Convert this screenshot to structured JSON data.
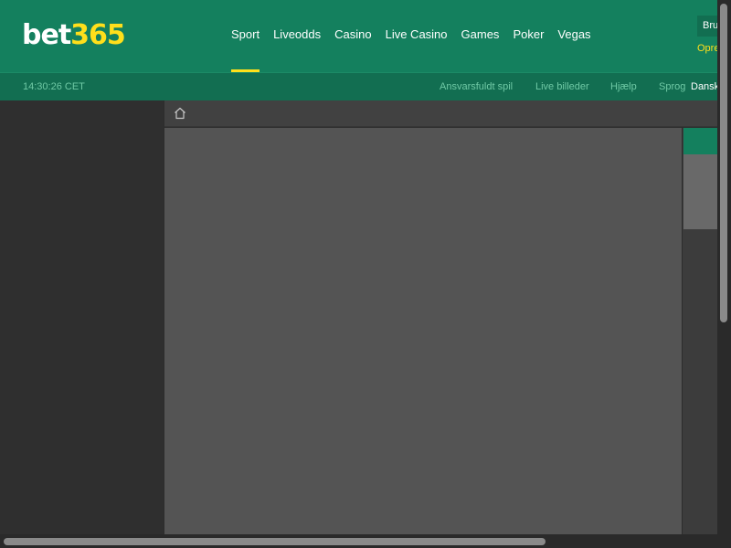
{
  "header": {
    "logo": {
      "part1": "bet",
      "part2": "365"
    },
    "nav": [
      {
        "label": "Sport",
        "active": true
      },
      {
        "label": "Liveodds"
      },
      {
        "label": "Casino"
      },
      {
        "label": "Live Casino"
      },
      {
        "label": "Games"
      },
      {
        "label": "Poker"
      },
      {
        "label": "Vegas"
      }
    ],
    "login_button": "Bru",
    "join_link": "Opre"
  },
  "subheader": {
    "clock": "14:30:26 CET",
    "links": {
      "responsible_gambling": "Ansvarsfuldt spil",
      "live_images": "Live billeder",
      "help": "Hjælp",
      "language_label": "Sprog"
    },
    "language_value": "Dansk"
  },
  "breadcrumb": {
    "icon": "home-icon"
  },
  "colors": {
    "brand_green": "#14805e",
    "brand_green_dark": "#126e51",
    "accent_yellow": "#ffdf1b",
    "link_green": "#6fc9a5"
  }
}
